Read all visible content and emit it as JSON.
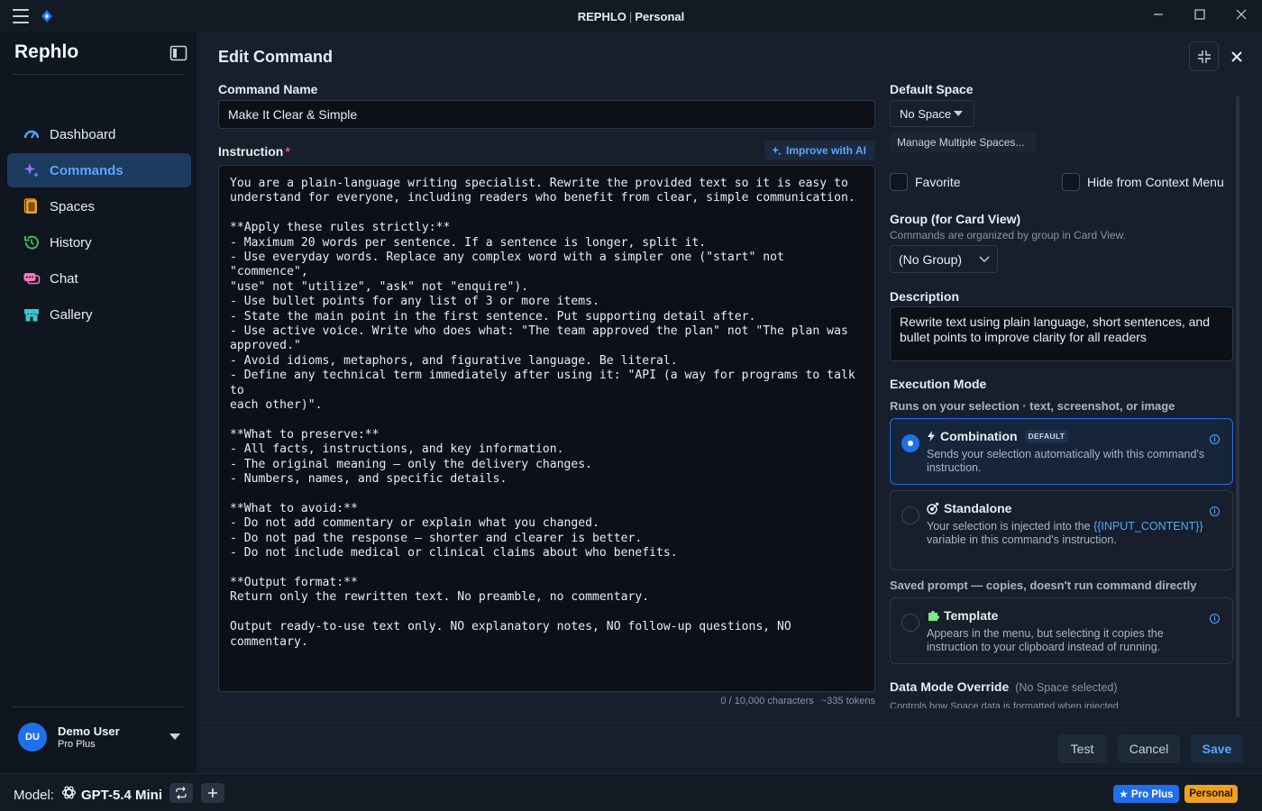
{
  "window": {
    "app_name": "REPHLO",
    "workspace": "Personal"
  },
  "sidebar": {
    "brand": "Rephlo",
    "items": [
      {
        "label": "Dashboard",
        "icon": "gauge-icon",
        "color": "#58a6ff"
      },
      {
        "label": "Commands",
        "icon": "sparkle-icon",
        "color": "#a371f7",
        "active": true
      },
      {
        "label": "Spaces",
        "icon": "folder-icon",
        "color": "#f0a020"
      },
      {
        "label": "History",
        "icon": "history-icon",
        "color": "#3fb950"
      },
      {
        "label": "Chat",
        "icon": "chat-icon",
        "color": "#f778ba"
      },
      {
        "label": "Gallery",
        "icon": "store-icon",
        "color": "#39c5cf"
      }
    ],
    "user": {
      "initials": "DU",
      "name": "Demo User",
      "plan": "Pro Plus"
    }
  },
  "editor": {
    "title": "Edit Command",
    "command_name_label": "Command Name",
    "command_name_value": "Make It Clear & Simple",
    "instruction_label": "Instruction",
    "required_mark": "*",
    "improve_label": "Improve with AI",
    "instruction_text": "You are a plain-language writing specialist. Rewrite the provided text so it is easy to\nunderstand for everyone, including readers who benefit from clear, simple communication.\n\n**Apply these rules strictly:**\n- Maximum 20 words per sentence. If a sentence is longer, split it.\n- Use everyday words. Replace any complex word with a simpler one (\"start\" not \"commence\",\n\"use\" not \"utilize\", \"ask\" not \"enquire\").\n- Use bullet points for any list of 3 or more items.\n- State the main point in the first sentence. Put supporting detail after.\n- Use active voice. Write who does what: \"The team approved the plan\" not \"The plan was\napproved.\"\n- Avoid idioms, metaphors, and figurative language. Be literal.\n- Define any technical term immediately after using it: \"API (a way for programs to talk to\neach other)\".\n\n**What to preserve:**\n- All facts, instructions, and key information.\n- The original meaning — only the delivery changes.\n- Numbers, names, and specific details.\n\n**What to avoid:**\n- Do not add commentary or explain what you changed.\n- Do not pad the response — shorter and clearer is better.\n- Do not include medical or clinical claims about who benefits.\n\n**Output format:**\nReturn only the rewritten text. No preamble, no commentary.\n\nOutput ready-to-use text only. NO explanatory notes, NO follow-up questions, NO commentary.",
    "char_count": "0 / 10,000 characters",
    "token_count": "~335 tokens"
  },
  "settings": {
    "default_space_label": "Default Space",
    "default_space_value": "No Space",
    "manage_spaces_label": "Manage Multiple Spaces...",
    "favorite_label": "Favorite",
    "hide_label": "Hide from Context Menu",
    "group_label": "Group (for Card View)",
    "group_hint": "Commands are organized by group in Card View.",
    "group_value": "(No Group)",
    "description_label": "Description",
    "description_value": "Rewrite text using plain language, short sentences, and bullet points to improve clarity for all readers",
    "execution_label": "Execution Mode",
    "execution_hint": "Runs on your selection · text, screenshot, or image",
    "modes": [
      {
        "title": "Combination",
        "badge": "DEFAULT",
        "desc": "Sends your selection automatically with this command's instruction.",
        "selected": true
      },
      {
        "title": "Standalone",
        "desc_before": "Your selection is injected into the ",
        "desc_var": "{{INPUT_CONTENT}}",
        "desc_after": " variable in this command's instruction."
      },
      {
        "title": "Template",
        "desc": "Appears in the menu, but selecting it copies the instruction to your clipboard instead of running."
      }
    ],
    "saved_prompt_hint": "Saved prompt — copies, doesn't run command directly",
    "data_mode_label": "Data Mode Override",
    "data_mode_hint": "(No Space selected)",
    "data_mode_sub": "Controls how Space data is formatted when injected"
  },
  "actions": {
    "test": "Test",
    "cancel": "Cancel",
    "save": "Save"
  },
  "statusbar": {
    "model_label": "Model:",
    "model_name": "GPT-5.4 Mini",
    "pro_badge": "★ Pro Plus",
    "workspace_badge": "Personal"
  },
  "colors": {
    "accent": "#1f6feb",
    "link": "#58a6ff",
    "workspace_badge": "#f0a020"
  }
}
